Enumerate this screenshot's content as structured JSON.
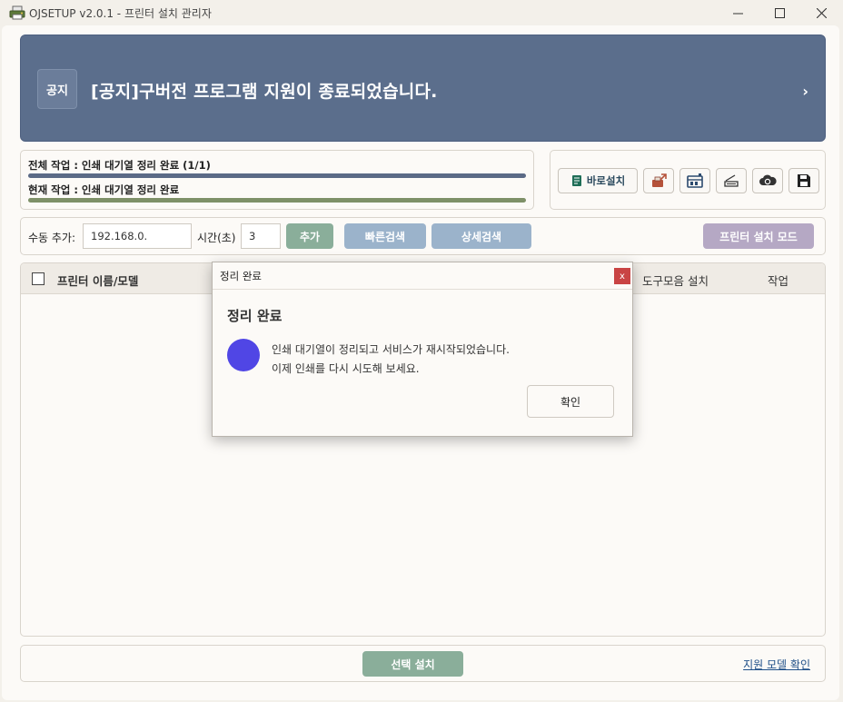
{
  "window": {
    "title": "OJSETUP v2.0.1 - 프린터 설치 관리자",
    "minimize_icon": "minimize-icon",
    "maximize_icon": "maximize-icon",
    "close_icon": "close-icon"
  },
  "banner": {
    "badge": "공지",
    "text": "[공지]구버전 프로그램 지원이 종료되었습니다.",
    "arrow": "›",
    "bg_color": "#5b6e8c"
  },
  "progress": {
    "overall_label": "전체 작업 : 인쇄 대기열 정리 완료 (1/1)",
    "overall_value": 1.0,
    "overall_color": "#5b6a86",
    "current_label": "현재 작업 : 인쇄 대기열 정리 완료",
    "current_value": 1.0,
    "current_color": "#7e9068"
  },
  "tools": {
    "quick_install_label": "바로설치",
    "icons": [
      "printer-doc-icon",
      "printer-arrow-icon",
      "queue-icon",
      "scanner-icon",
      "cloud-sync-icon",
      "save-icon"
    ]
  },
  "search": {
    "manual_add_label": "수동 추가:",
    "ip_value": "192.168.0.",
    "time_label": "시간(초)",
    "time_value": "3",
    "add_button": "추가",
    "quick_search_button": "빠른검색",
    "detail_search_button": "상세검색",
    "install_mode_button": "프린터 설치 모드"
  },
  "list": {
    "columns": {
      "name": "프린터 이름/모델",
      "toolbar": "도구모음 설치",
      "action": "작업"
    }
  },
  "bottom": {
    "install_selected": "선택 설치",
    "support_models": "지원 모델 확인"
  },
  "dialog": {
    "title": "정리 완료",
    "close": "x",
    "heading": "정리 완료",
    "message_line1": "인쇄 대기열이 정리되고 서비스가 재시작되었습니다.",
    "message_line2": "이제 인쇄를 다시 시도해 보세요.",
    "ok_button": "확인",
    "indicator_color": "#5046e5"
  }
}
